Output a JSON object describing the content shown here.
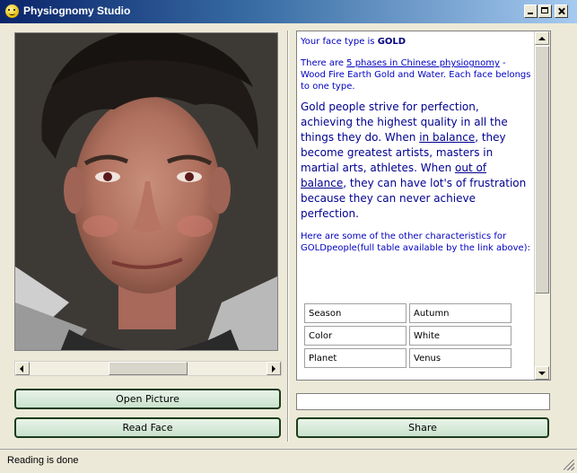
{
  "window": {
    "title": "Physiognomy Studio",
    "icon": "smiley-icon"
  },
  "left": {
    "open_button": "Open Picture",
    "read_button": "Read Face"
  },
  "reading": {
    "type_prefix": "Your face type is ",
    "type_value": "GOLD",
    "phases_pre": "There are ",
    "phases_link": "5 phases in Chinese physiognomy",
    "phases_post": " - Wood Fire Earth Gold and Water. Each face belongs to one type.",
    "gold_1": "Gold people strive for perfection, achieving the highest quality in all the things they do. When ",
    "gold_link1": "in balance",
    "gold_2": ", they become greatest artists, masters in martial arts, athletes. When ",
    "gold_link2": "out of balance",
    "gold_3": ", they can have lot's of frustration because they can never achieve perfection.",
    "other": "Here are some of the other characteristics for GOLDpeople(full table available by the link above):",
    "table": [
      {
        "key": "Season",
        "value": "Autumn"
      },
      {
        "key": "Color",
        "value": "White"
      },
      {
        "key": "Planet",
        "value": "Venus"
      }
    ]
  },
  "right": {
    "share_button": "Share",
    "share_input_value": ""
  },
  "status": {
    "text": "Reading is done"
  }
}
